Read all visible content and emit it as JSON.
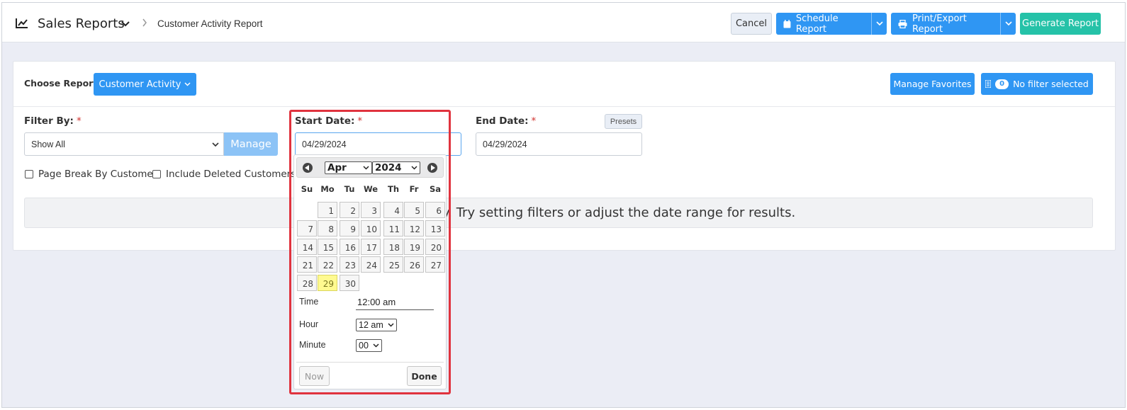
{
  "header": {
    "title": "Sales Reports",
    "breadcrumb_current": "Customer Activity Report",
    "cancel": "Cancel",
    "schedule": "Schedule Report",
    "print": "Print/Export Report",
    "generate": "Generate Report"
  },
  "toolbar": {
    "choose_label": "Choose Report",
    "report_value": "Customer Activity",
    "favorites": "Manage Favorites",
    "filter_count": "0",
    "filter_text": "No filter selected"
  },
  "form": {
    "filter_label": "Filter By:",
    "filter_value": "Show All",
    "manage": "Manage",
    "page_break": "Page Break By Customer",
    "include_deleted": "Include Deleted Customers",
    "start_label": "Start Date:",
    "start_value": "04/29/2024",
    "end_label": "End Date:",
    "end_value": "04/29/2024",
    "presets": "Presets",
    "required_mark": "*"
  },
  "empty_message": "This report is empty. Try setting filters or adjust the date range for results.",
  "datepicker": {
    "month": "Apr",
    "year": "2024",
    "weekdays": [
      "Su",
      "Mo",
      "Tu",
      "We",
      "Th",
      "Fr",
      "Sa"
    ],
    "days": [
      "1",
      "2",
      "3",
      "4",
      "5",
      "6",
      "7",
      "8",
      "9",
      "10",
      "11",
      "12",
      "13",
      "14",
      "15",
      "16",
      "17",
      "18",
      "19",
      "20",
      "21",
      "22",
      "23",
      "24",
      "25",
      "26",
      "27",
      "28",
      "29",
      "30"
    ],
    "selected_day": "29",
    "time_label": "Time",
    "time_value": "12:00 am",
    "hour_label": "Hour",
    "hour_value": "12 am",
    "minute_label": "Minute",
    "minute_value": "00",
    "now": "Now",
    "done": "Done"
  },
  "colors": {
    "primary": "#2f96f3",
    "success": "#25c2a8",
    "highlight": "#e0333e",
    "today": "#fffa90"
  }
}
